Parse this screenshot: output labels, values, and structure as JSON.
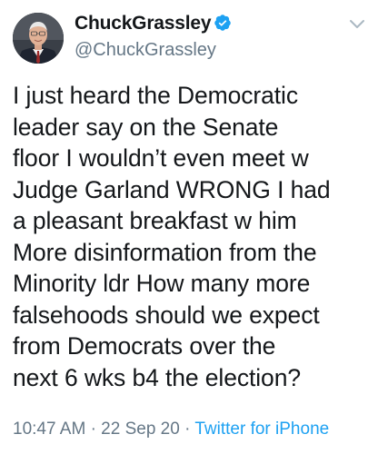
{
  "author": {
    "display_name": "ChuckGrassley",
    "handle": "@ChuckGrassley",
    "verified": true,
    "avatar_icon": "profile-photo"
  },
  "tweet": {
    "text": "I just heard the Democratic\nleader say on the Senate\nfloor I wouldn’t even meet w\nJudge Garland WRONG I had\na pleasant breakfast w him\nMore disinformation from the\nMinority ldr How many more\nfalsehoods should we expect\nfrom Democrats over the\nnext 6 wks b4 the election?"
  },
  "meta": {
    "time": "10:47 AM",
    "separator": "·",
    "date": "22 Sep 20",
    "source": "Twitter for iPhone"
  },
  "colors": {
    "text": "#14171a",
    "secondary": "#657786",
    "link": "#1da1f2"
  }
}
